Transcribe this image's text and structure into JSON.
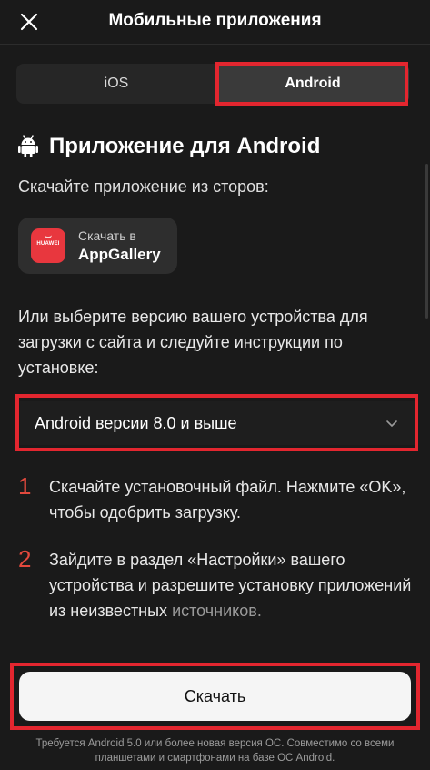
{
  "header": {
    "title": "Мобильные приложения",
    "close_icon": "close-icon"
  },
  "tabs": [
    {
      "label": "iOS",
      "active": false
    },
    {
      "label": "Android",
      "active": true
    }
  ],
  "section": {
    "icon": "android-icon",
    "title": "Приложение для Android",
    "subtitle": "Скачайте приложение из сторов:"
  },
  "store": {
    "logo_text": "HUAWEI",
    "small_label": "Скачать в",
    "name": "AppGallery"
  },
  "instructions": "Или выберите версию вашего устройства для загрузки с сайта и следуйте инструкции по установке:",
  "version_select": {
    "selected": "Android версии 8.0 и выше"
  },
  "steps": [
    {
      "number": "1",
      "text": "Скачайте установочный файл. Нажмите «OK», чтобы одобрить загрузку."
    },
    {
      "number": "2",
      "text": "Зайдите в раздел «Настройки» вашего устройства и разрешите установку приложений из неизвестных",
      "text_faded": "источников."
    }
  ],
  "download_button": "Скачать",
  "footer": "Требуется Android 5.0 или более новая версия ОС. Совместимо со всеми планшетами и смартфонами на базе ОС Android.",
  "colors": {
    "background": "#1a1a1a",
    "highlight": "#e3262f",
    "step_number": "#e2493d",
    "huawei_red": "#e8373e"
  }
}
